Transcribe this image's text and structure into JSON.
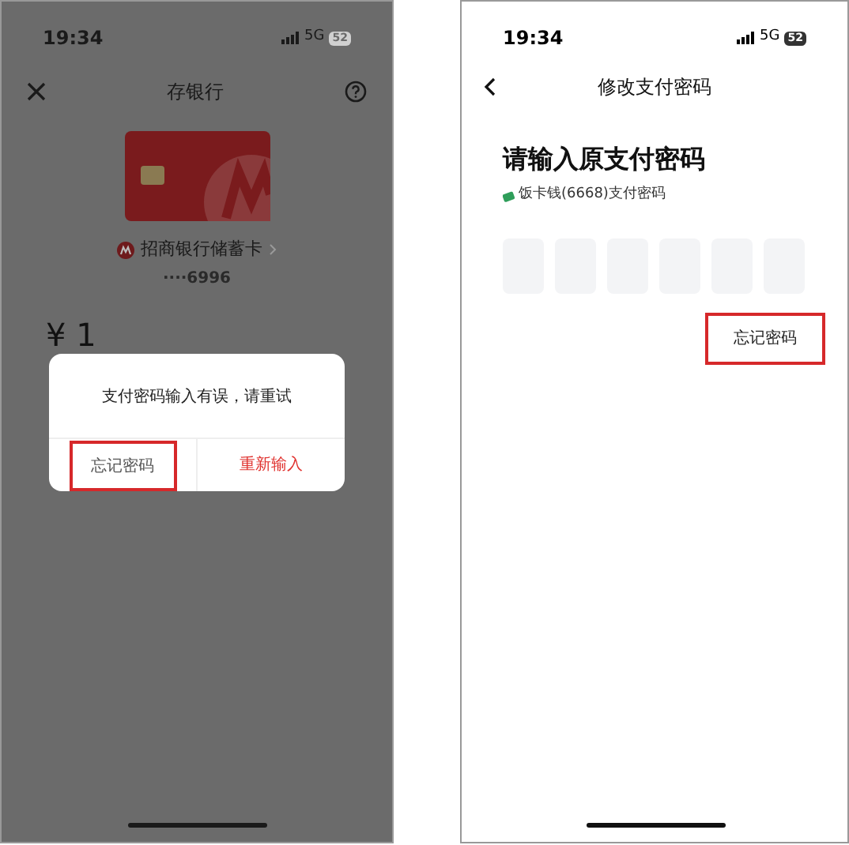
{
  "left_screen": {
    "status_bar": {
      "time": "19:34",
      "network": "5G",
      "battery": "52"
    },
    "nav": {
      "title": "存银行"
    },
    "card": {
      "bank_name": "招商银行储蓄卡",
      "number": "····6996"
    },
    "amount": "¥ 1",
    "dialog": {
      "message": "支付密码输入有误，请重试",
      "buttons": [
        {
          "label": "忘记密码",
          "kind": "secondary",
          "highlighted": true
        },
        {
          "label": "重新输入",
          "kind": "primary",
          "highlighted": false
        }
      ]
    }
  },
  "right_screen": {
    "status_bar": {
      "time": "19:34",
      "network": "5G",
      "battery": "52"
    },
    "nav": {
      "title": "修改支付密码"
    },
    "heading": "请输入原支付密码",
    "subtitle": "饭卡钱(6668)支付密码",
    "pin_boxes": [
      {
        "kind": "empty"
      },
      {
        "kind": "empty"
      },
      {
        "kind": "empty"
      },
      {
        "kind": "empty"
      },
      {
        "kind": "empty"
      },
      {
        "kind": "empty"
      }
    ],
    "forgot_link": {
      "label": "忘记密码",
      "highlighted": true
    }
  }
}
